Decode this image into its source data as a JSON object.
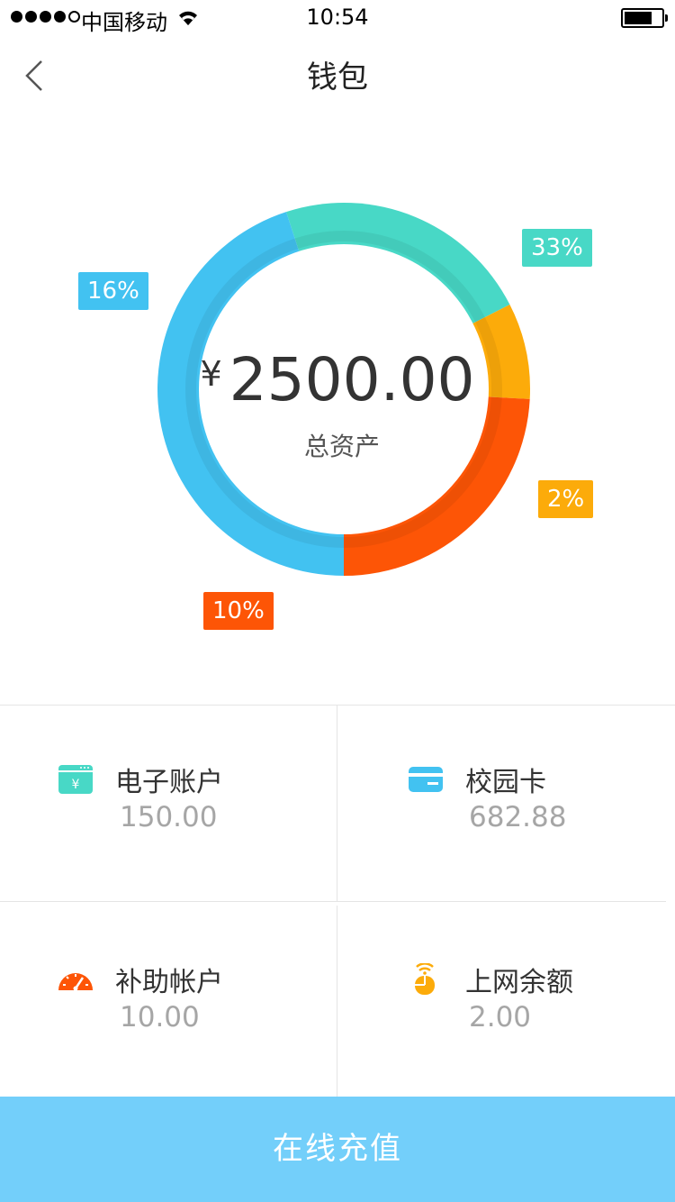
{
  "status_bar": {
    "carrier": "中国移动",
    "time": "10:54",
    "signal_bars_filled": 4,
    "signal_bars_total": 5
  },
  "nav": {
    "title": "钱包",
    "back_icon": "chevron-left-icon"
  },
  "summary": {
    "currency_symbol": "¥",
    "total_amount": "2500.00",
    "total_label": "总资产"
  },
  "donut": {
    "segments": [
      {
        "label": "33%",
        "color": "#48d8c6",
        "start": -18,
        "end": 63
      },
      {
        "label": "2%",
        "color": "#fcab0a",
        "start": 63,
        "end": 93
      },
      {
        "label": "10%",
        "color": "#fd5506",
        "start": 93,
        "end": 180
      },
      {
        "label": "16%",
        "color": "#42c2f1",
        "start": 180,
        "end": 342
      }
    ]
  },
  "accounts": [
    {
      "title": "电子账户",
      "value": "150.00",
      "icon": "wallet-yen-icon",
      "color": "#48d8c6"
    },
    {
      "title": "校园卡",
      "value": "682.88",
      "icon": "card-icon",
      "color": "#42c2f1"
    },
    {
      "title": "补助帐户",
      "value": "10.00",
      "icon": "speedometer-icon",
      "color": "#fd5506"
    },
    {
      "title": "上网余额",
      "value": "2.00",
      "icon": "mouse-wifi-icon",
      "color": "#fcab0a"
    }
  ],
  "footer": {
    "recharge_label": "在线充值",
    "color": "#73cffa"
  }
}
